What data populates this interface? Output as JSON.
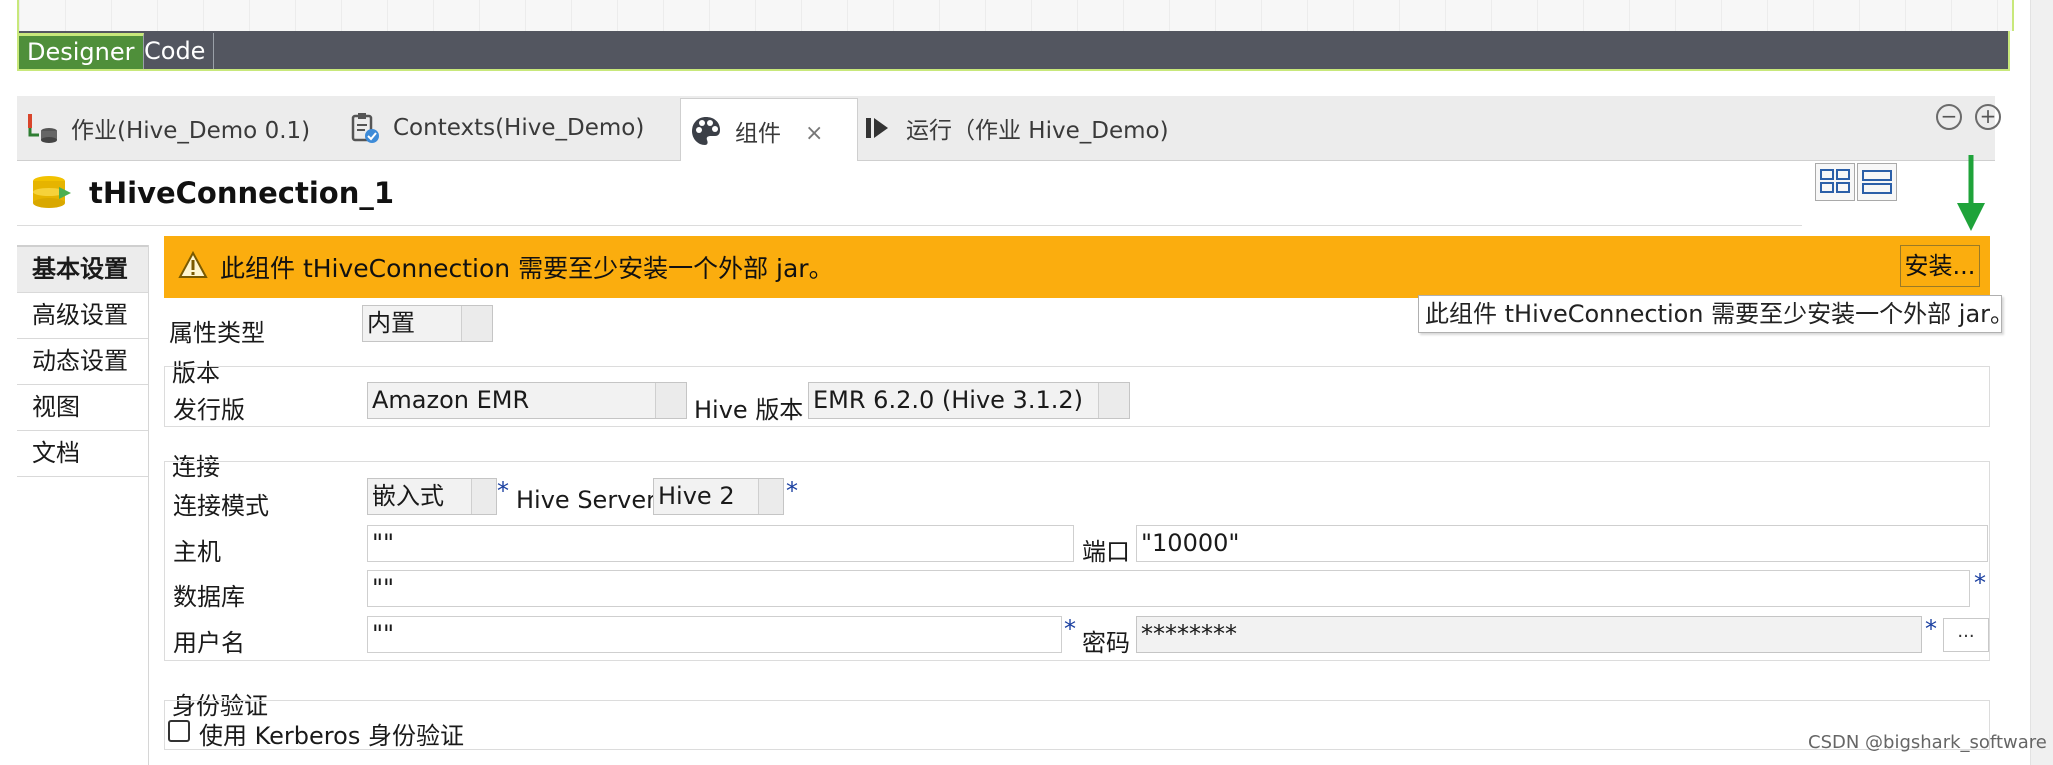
{
  "top_tabs": [
    "Designer",
    "Code"
  ],
  "editor_tabs": [
    {
      "label": "作业(Hive_Demo 0.1)",
      "icon": "job-icon"
    },
    {
      "label": "Contexts(Hive_Demo)",
      "icon": "contexts-clipboard-icon"
    },
    {
      "label": "组件",
      "icon": "palette-icon",
      "active": true,
      "close": "×"
    },
    {
      "label": "运行（作业 Hive_Demo)",
      "icon": "run-icon"
    }
  ],
  "window_buttons": {
    "minimize": "−",
    "maximize": "+"
  },
  "component": {
    "name": "tHiveConnection_1",
    "icon": "database-connection-icon"
  },
  "nav": [
    "基本设置",
    "高级设置",
    "动态设置",
    "视图",
    "文档"
  ],
  "warning": {
    "message": "此组件 tHiveConnection 需要至少安装一个外部 jar。",
    "install_label": "安装...",
    "tooltip": "此组件 tHiveConnection 需要至少安装一个外部 jar。",
    "color": "#fbad0e"
  },
  "form": {
    "property_type_label": "属性类型",
    "property_type_value": "内置",
    "version_group": "版本",
    "distribution_label": "发行版",
    "distribution_value": "Amazon EMR",
    "hive_version_label": "Hive 版本",
    "hive_version_value": "EMR 6.2.0 (Hive 3.1.2)",
    "connection_group": "连接",
    "conn_mode_label": "连接模式",
    "conn_mode_value": "嵌入式",
    "hive_server_label": "Hive Server",
    "hive_server_value": "Hive 2",
    "host_label": "主机",
    "host_value": "\"\"",
    "port_label": "端口",
    "port_value": "\"10000\"",
    "database_label": "数据库",
    "database_value": "\"\"",
    "username_label": "用户名",
    "username_value": "\"\"",
    "password_label": "密码",
    "password_value": "********",
    "dots_label": "...",
    "required_mark": "*",
    "auth_group": "身份验证",
    "kerberos_label": "使用 Kerberos 身份验证",
    "kerberos_checked": false
  },
  "watermark": "CSDN @bigshark_software",
  "accent_colors": {
    "designer_active": "#4f8f3a",
    "arrow": "#1fa33a"
  }
}
